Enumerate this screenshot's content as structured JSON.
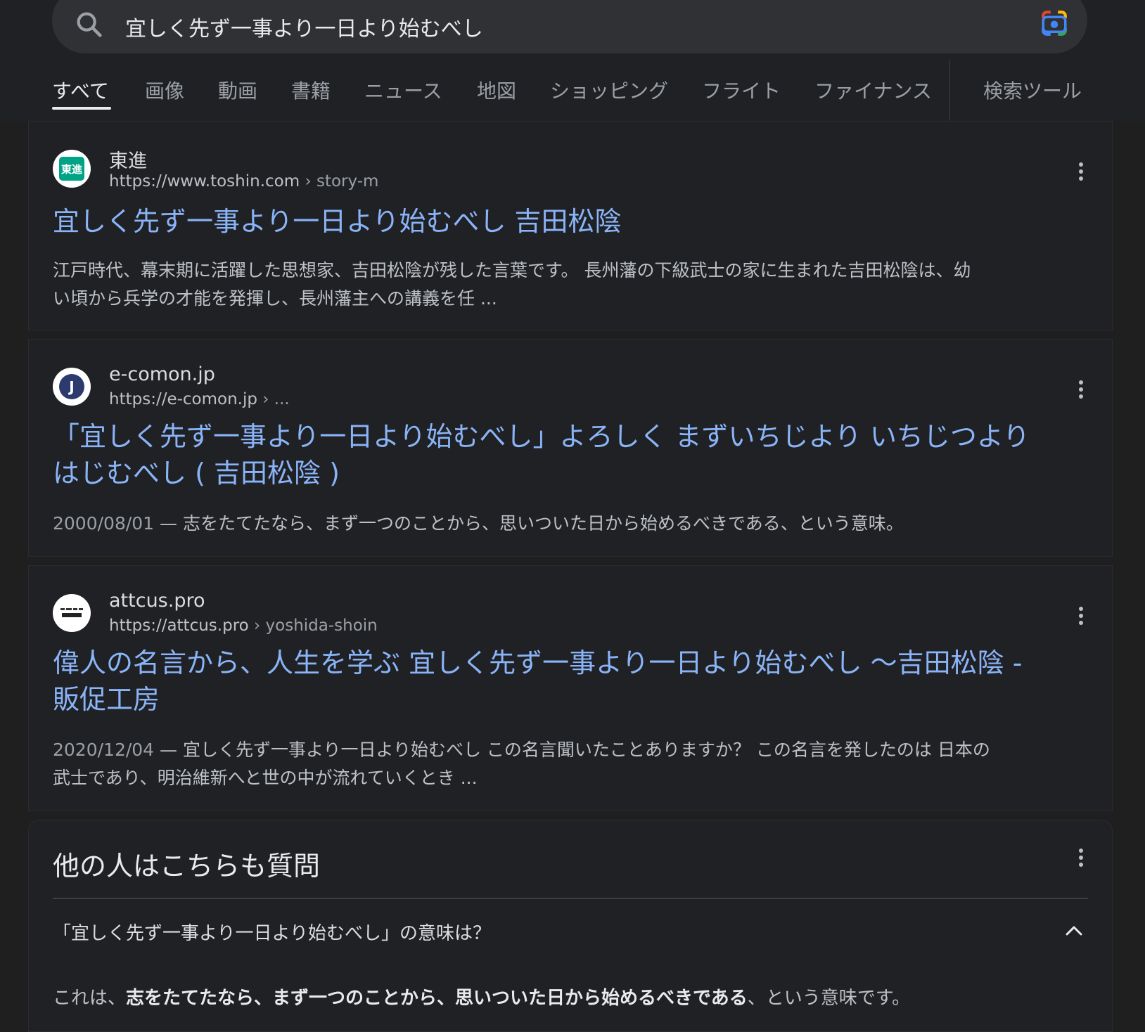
{
  "search": {
    "query": "宜しく先ず一事より一日より始むべし"
  },
  "tabs": [
    {
      "label": "すべて",
      "active": true
    },
    {
      "label": "画像"
    },
    {
      "label": "動画"
    },
    {
      "label": "書籍"
    },
    {
      "label": "ニュース"
    },
    {
      "label": "地図"
    },
    {
      "label": "ショッピング"
    },
    {
      "label": "フライト"
    },
    {
      "label": "ファイナンス"
    },
    {
      "label": "検索ツール"
    }
  ],
  "results": [
    {
      "favicon_text": "東進",
      "site": "東進",
      "url": "https://www.toshin.com",
      "crumb": " › story-m",
      "title": "宜しく先ず一事より一日より始むべし 吉田松陰",
      "snippet_lines": [
        "江戸時代、幕末期に活躍した思想家、吉田松陰が残した言葉です。 長州藩の下級武士の家に生まれた吉田松陰は、幼",
        "い頃から兵学の才能を発揮し、長州藩主への講義を任 ..."
      ]
    },
    {
      "favicon_text": "J",
      "site": "e-comon.jp",
      "url": "https://e-comon.jp",
      "crumb": " › ...",
      "title_lines": [
        "「宜しく先ず一事より一日より始むべし」よろしく まずいちじより いちじつより",
        "はじむべし ( 吉田松陰 )"
      ],
      "date": "2000/08/01",
      "snippet_lines": [
        " — 志をたてたなら、まず一つのことから、思いついた日から始めるべきである、という意味。"
      ]
    },
    {
      "site": "attcus.pro",
      "url": "https://attcus.pro",
      "crumb": " › yoshida-shoin",
      "title_lines": [
        "偉人の名言から、人生を学ぶ 宜しく先ず一事より一日より始むべし ～吉田松陰 -",
        "販促工房"
      ],
      "date": "2020/12/04",
      "snippet_lines": [
        " — 宜しく先ず一事より一日より始むべし この名言聞いたことありますか？ この名言を発したのは 日本の",
        "武士であり、明治維新へと世の中が流れていくとき ..."
      ]
    }
  ],
  "paa": {
    "heading": "他の人はこちらも質問",
    "question": "「宜しく先ず一事より一日より始むべし」の意味は？",
    "answer_prefix": "これは、",
    "answer_bold": "志をたてたなら、まず一つのことから、思いついた日から始めるべきである",
    "answer_suffix": "、という意味です。"
  },
  "colors": {
    "background": "#1f1f1f",
    "link": "#8ab4f8",
    "toshin_green": "#00a386"
  }
}
